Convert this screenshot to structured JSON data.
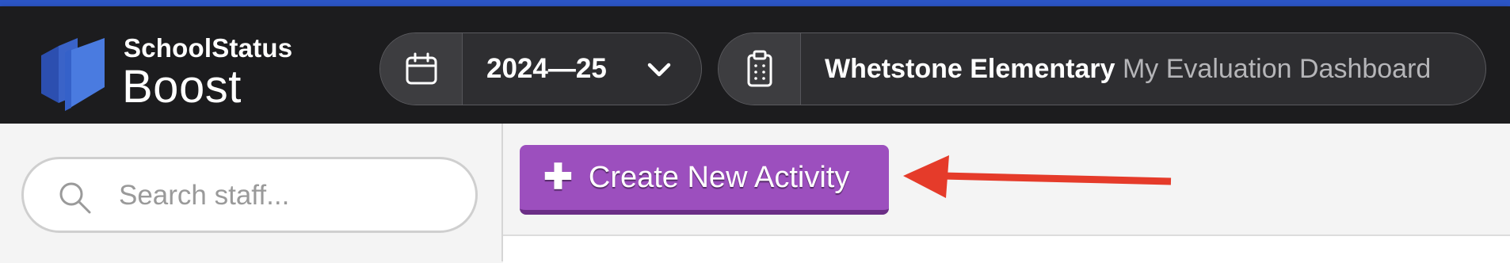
{
  "brand": {
    "top": "SchoolStatus",
    "bottom": "Boost"
  },
  "year_selector": {
    "value": "2024—25",
    "icon": "calendar-icon",
    "chevron": "chevron-down-icon"
  },
  "school_selector": {
    "school": "Whetstone Elementary",
    "dashboard": "My Evaluation Dashboard",
    "icon": "clipboard-icon"
  },
  "search": {
    "placeholder": "Search staff..."
  },
  "actions": {
    "create_label": "Create New Activity",
    "create_icon": "plus-icon"
  },
  "colors": {
    "accent": "#2b55c5",
    "header_bg": "#1c1c1e",
    "button": "#9c4fbe",
    "annotation_arrow": "#e53b2a"
  }
}
